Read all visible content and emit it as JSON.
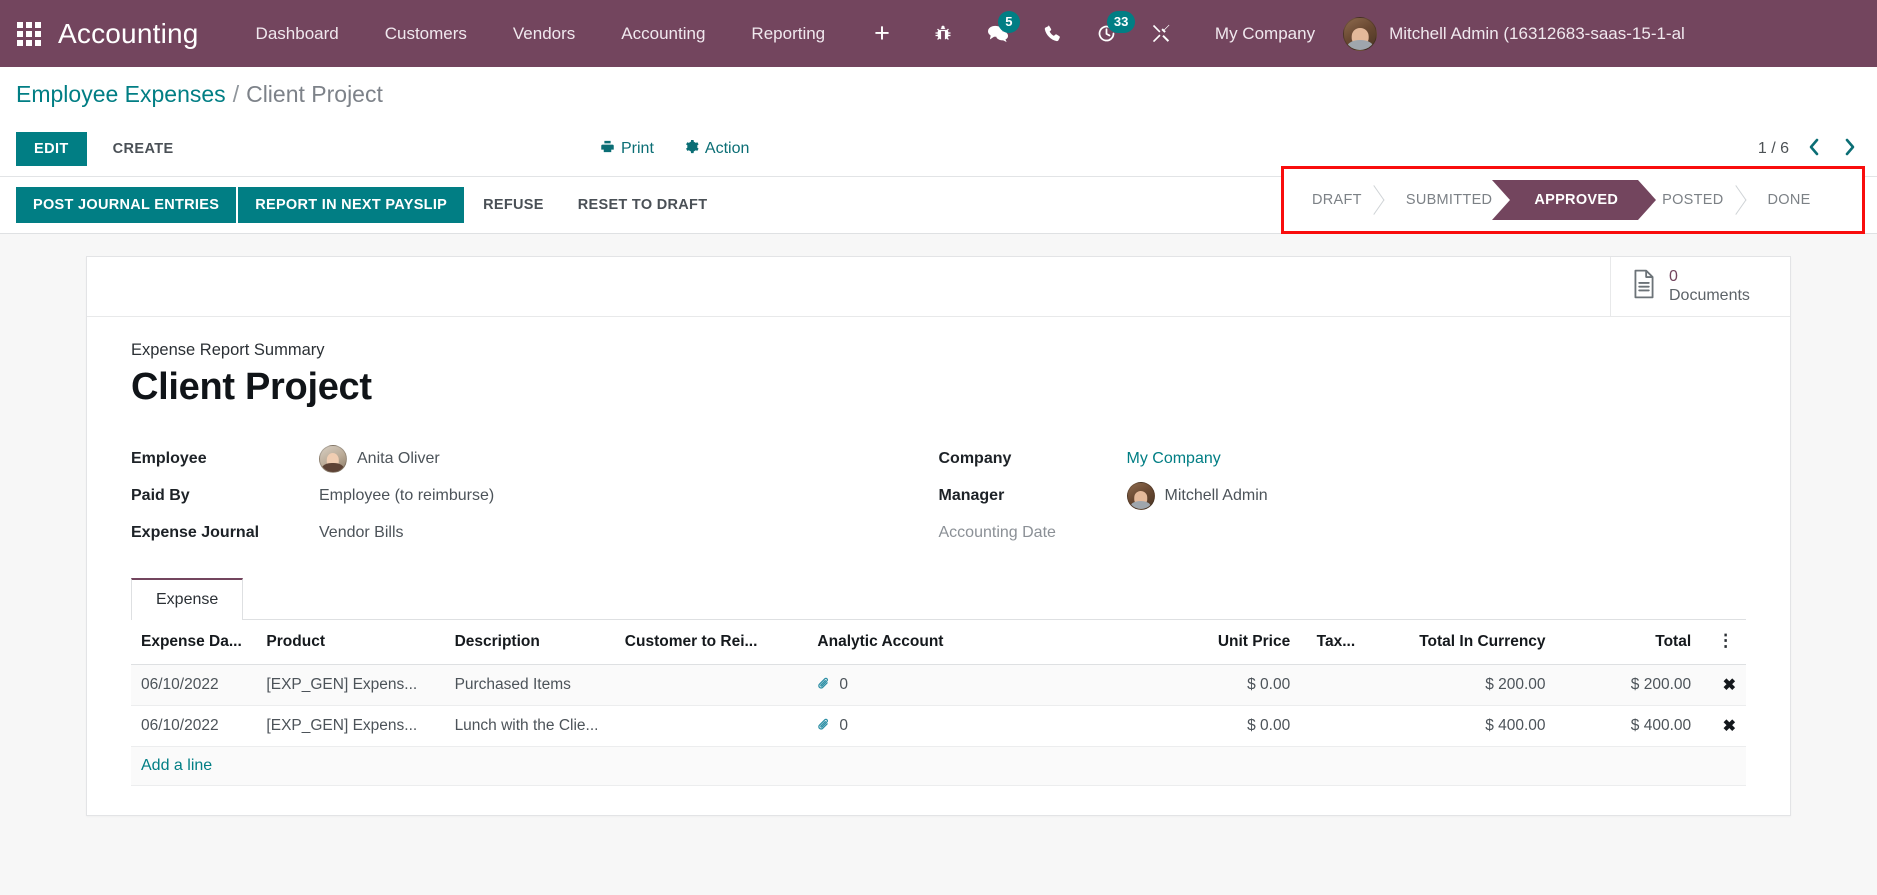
{
  "navbar": {
    "apps_icon": "grid-apps-icon",
    "brand": "Accounting",
    "menu_items": [
      {
        "label": "Dashboard"
      },
      {
        "label": "Customers"
      },
      {
        "label": "Vendors"
      },
      {
        "label": "Accounting"
      },
      {
        "label": "Reporting"
      }
    ],
    "plus_label": "+",
    "icons": [
      {
        "name": "bug-icon",
        "badge": null
      },
      {
        "name": "chat-icon",
        "badge": "5"
      },
      {
        "name": "phone-icon",
        "badge": null
      },
      {
        "name": "activity-clock-icon",
        "badge": "33"
      },
      {
        "name": "tools-icon",
        "badge": null
      }
    ],
    "company": "My Company",
    "user": "Mitchell Admin (16312683-saas-15-1-al"
  },
  "breadcrumb": {
    "parent": "Employee Expenses",
    "separator": "/",
    "current": "Client Project"
  },
  "control_panel": {
    "edit": "EDIT",
    "create": "CREATE",
    "print": "Print",
    "action": "Action",
    "pager_value": "1 / 6",
    "prev": "‹",
    "next": "›"
  },
  "statusbar": {
    "buttons": [
      {
        "label": "POST JOURNAL ENTRIES",
        "style": "primary"
      },
      {
        "label": "REPORT IN NEXT PAYSLIP",
        "style": "primary"
      },
      {
        "label": "REFUSE",
        "style": "secondary"
      },
      {
        "label": "RESET TO DRAFT",
        "style": "secondary"
      }
    ],
    "pipeline": [
      {
        "label": "DRAFT",
        "active": false
      },
      {
        "label": "SUBMITTED",
        "active": false
      },
      {
        "label": "APPROVED",
        "active": true
      },
      {
        "label": "POSTED",
        "active": false
      },
      {
        "label": "DONE",
        "active": false
      }
    ],
    "highlight_color": "#f90d0d",
    "active_color": "#73455e"
  },
  "stat_button": {
    "icon": "document-icon",
    "value": "0",
    "label": "Documents"
  },
  "form": {
    "subtitle": "Expense Report Summary",
    "title": "Client Project",
    "left_fields": [
      {
        "label": "Employee",
        "value": "Anita Oliver",
        "type": "avatar"
      },
      {
        "label": "Paid By",
        "value": "Employee (to reimburse)",
        "type": "text"
      },
      {
        "label": "Expense Journal",
        "value": "Vendor Bills",
        "type": "text"
      }
    ],
    "right_fields": [
      {
        "label": "Company",
        "value": "My Company",
        "type": "link"
      },
      {
        "label": "Manager",
        "value": "Mitchell Admin",
        "type": "avatar"
      },
      {
        "label": "Accounting Date",
        "value": "",
        "type": "empty"
      }
    ]
  },
  "notebook": {
    "tabs": [
      {
        "label": "Expense",
        "active": true
      }
    ],
    "columns": [
      "Expense Da...",
      "Product",
      "Description",
      "Customer to Rei...",
      "Analytic Account",
      "Unit Price",
      "Tax...",
      "Total In Currency",
      "Total"
    ],
    "optional_columns_icon": "vertical-dots-icon",
    "rows": [
      {
        "date": "06/10/2022",
        "product": "[EXP_GEN] Expens...",
        "description": "Purchased Items",
        "customer_to_reinvoice": "",
        "analytic_account": "",
        "attachment_icon": "paperclip-icon",
        "attachment_count": "0",
        "unit_price": "$ 0.00",
        "taxes": "",
        "total_in_currency": "$ 200.00",
        "total": "$ 200.00",
        "delete_icon": "✖"
      },
      {
        "date": "06/10/2022",
        "product": "[EXP_GEN] Expens...",
        "description": "Lunch with the Clie...",
        "customer_to_reinvoice": "",
        "analytic_account": "",
        "attachment_icon": "paperclip-icon",
        "attachment_count": "0",
        "unit_price": "$ 0.00",
        "taxes": "",
        "total_in_currency": "$ 400.00",
        "total": "$ 400.00",
        "delete_icon": "✖"
      }
    ],
    "add_line": "Add a line"
  }
}
